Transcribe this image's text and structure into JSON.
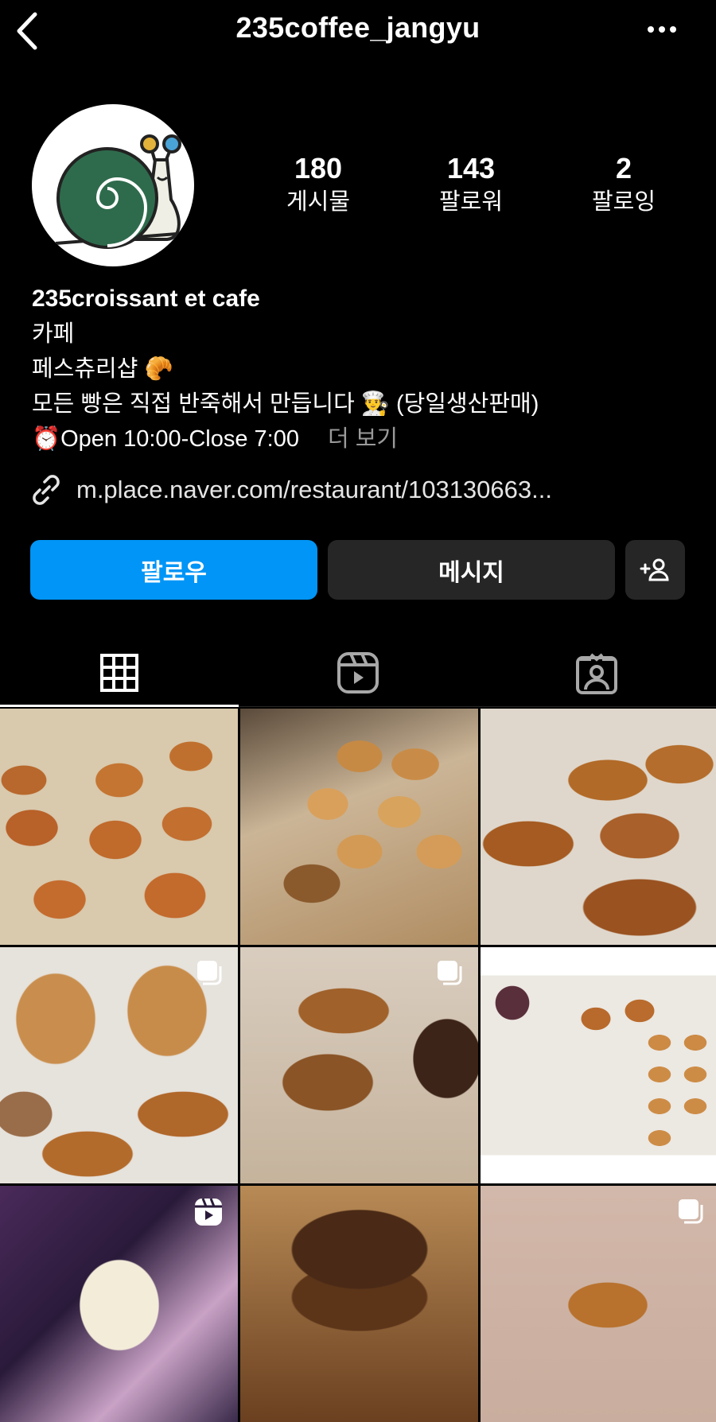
{
  "header": {
    "username": "235coffee_jangyu",
    "back_icon": "chevron-left-icon",
    "more_icon": "ellipsis-icon"
  },
  "stats": [
    {
      "value": "180",
      "label": "게시물"
    },
    {
      "value": "143",
      "label": "팔로워"
    },
    {
      "value": "2",
      "label": "팔로잉"
    }
  ],
  "bio": {
    "name": "235croissant et cafe",
    "category": "카페",
    "line1": "페스츄리샵 🥐",
    "line2": "모든 빵은 직접 반죽해서 만듭니다 👨‍🍳 (당일생산판매)",
    "line3": "⏰Open 10:00-Close 7:00",
    "more_label": "더 보기",
    "link": "m.place.naver.com/restaurant/103130663..."
  },
  "actions": {
    "follow_label": "팔로우",
    "message_label": "메시지",
    "add_user_icon": "add-person-icon"
  },
  "tabs": [
    {
      "name": "posts",
      "icon": "grid-icon",
      "active": true
    },
    {
      "name": "reels",
      "icon": "reels-icon",
      "active": false
    },
    {
      "name": "tagged",
      "icon": "tagged-person-icon",
      "active": false
    }
  ],
  "colors": {
    "background": "#000000",
    "primary_button": "#0095f6",
    "secondary_button": "#262626",
    "muted_text": "#9a9a9a"
  },
  "posts": [
    {
      "subject": "madeleines on baking tray",
      "badge": null
    },
    {
      "subject": "croissants on display",
      "badge": null
    },
    {
      "subject": "croissants close-up",
      "badge": null
    },
    {
      "subject": "pastry loaves with price tag",
      "badge": "carousel-icon"
    },
    {
      "subject": "pain au chocolat with price tag",
      "badge": "carousel-icon"
    },
    {
      "subject": "pastry display overhead",
      "badge": null
    },
    {
      "subject": "glass of milk drink",
      "badge": "reels-icon"
    },
    {
      "subject": "chocolate pastry close-up",
      "badge": null
    },
    {
      "subject": "croissant on plate",
      "badge": "carousel-icon"
    }
  ]
}
